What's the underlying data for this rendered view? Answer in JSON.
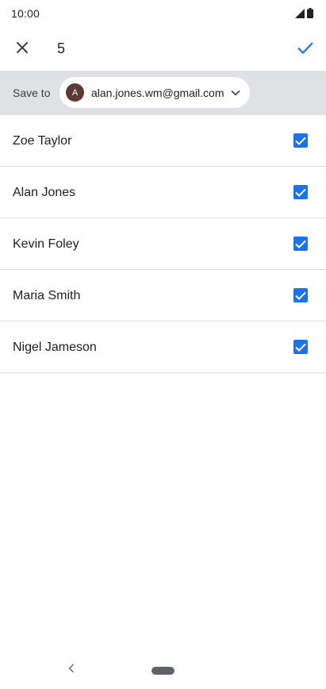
{
  "status_bar": {
    "time": "10:00",
    "icons": [
      "signal-icon",
      "battery-icon"
    ]
  },
  "app_bar": {
    "close_icon": "close-icon",
    "count": "5",
    "done_icon": "check-icon",
    "accent_color": "#1a73e8"
  },
  "save_to": {
    "label": "Save to",
    "avatar_letter": "A",
    "avatar_color": "#5d3a33",
    "email": "alan.jones.wm@gmail.com",
    "chevron_icon": "chevron-down-icon"
  },
  "contacts": [
    {
      "name": "Zoe Taylor",
      "checked": true
    },
    {
      "name": "Alan Jones",
      "checked": true
    },
    {
      "name": "Kevin Foley",
      "checked": true
    },
    {
      "name": "Maria Smith",
      "checked": true
    },
    {
      "name": "Nigel Jameson",
      "checked": true
    }
  ],
  "nav_bar": {
    "back_icon": "back-chevron-icon",
    "home_icon": "home-pill-icon"
  }
}
